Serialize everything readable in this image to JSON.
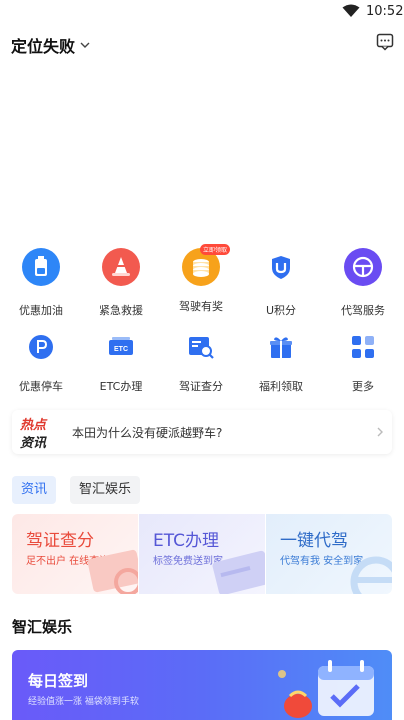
{
  "status_bar": {
    "time": "10:52"
  },
  "header": {
    "location": "定位失败"
  },
  "services": {
    "row1": [
      {
        "label": "优惠加油",
        "icon": "fuel-icon",
        "color": "#2e86f7"
      },
      {
        "label": "紧急救援",
        "icon": "rescue-cone-icon",
        "color": "#f25a4f"
      },
      {
        "label": "驾驶有奖",
        "icon": "coin-stack-icon",
        "color": "#f7a21b",
        "badge": "立即领取"
      },
      {
        "label": "U积分",
        "icon": "u-shield-icon",
        "color": "#2f6ff0"
      },
      {
        "label": "代驾服务",
        "icon": "steering-wheel-icon",
        "color": "#6a4cf2"
      }
    ],
    "row2": [
      {
        "label": "优惠停车",
        "icon": "parking-icon",
        "color": "#2f6ff0"
      },
      {
        "label": "ETC办理",
        "icon": "etc-card-icon",
        "color": "#2f6ff0"
      },
      {
        "label": "驾证查分",
        "icon": "license-search-icon",
        "color": "#2f6ff0"
      },
      {
        "label": "福利领取",
        "icon": "gift-icon",
        "color": "#2f6ff0"
      },
      {
        "label": "更多",
        "icon": "more-grid-icon",
        "color": "#2f6ff0"
      }
    ]
  },
  "news": {
    "tag_top": "热点",
    "tag_bottom": "资讯",
    "headline": "本田为什么没有硬派越野车?"
  },
  "tabs": [
    {
      "label": "资讯",
      "active": true
    },
    {
      "label": "智汇娱乐",
      "active": false
    }
  ],
  "cards": [
    {
      "title": "驾证查分",
      "subtitle": "足不出户 在线查询"
    },
    {
      "title": "ETC办理",
      "subtitle": "标签免费送到家"
    },
    {
      "title": "一键代驾",
      "subtitle": "代驾有我 安全到家"
    }
  ],
  "section": {
    "title": "智汇娱乐"
  },
  "banner": {
    "title": "每日签到",
    "subtitle": "经验值涨一涨 福袋领到手软"
  },
  "colors": {
    "accent": "#2f6ff0",
    "red": "#e94b3c",
    "purple": "#5557d6"
  }
}
